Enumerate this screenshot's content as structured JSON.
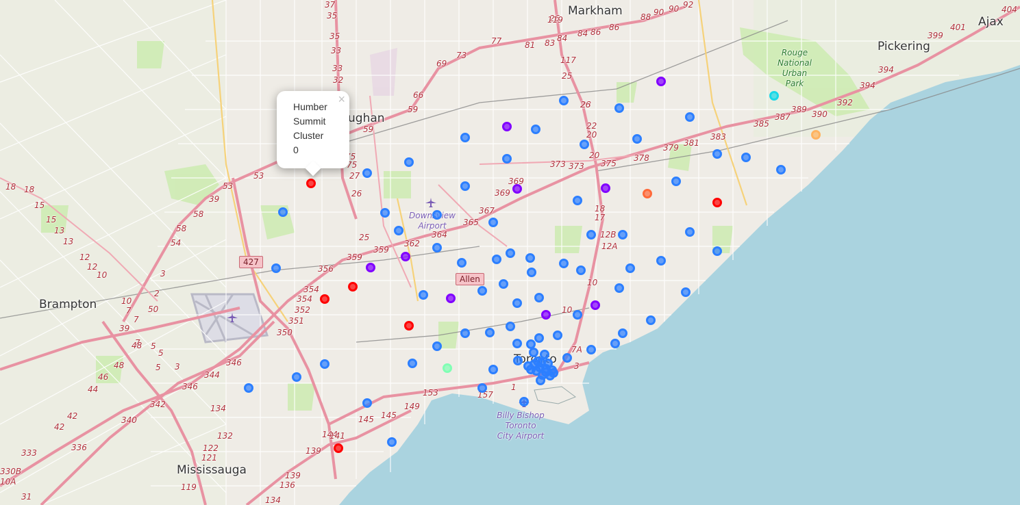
{
  "map": {
    "places": [
      {
        "id": "markham",
        "label": "Markham",
        "kind": "city"
      },
      {
        "id": "ajax",
        "label": "Ajax",
        "kind": "city"
      },
      {
        "id": "pickering",
        "label": "Pickering",
        "kind": "city"
      },
      {
        "id": "vaughan",
        "label": "ughan",
        "kind": "city"
      },
      {
        "id": "brampton",
        "label": "Brampton",
        "kind": "city"
      },
      {
        "id": "mississauga",
        "label": "Mississauga",
        "kind": "city"
      },
      {
        "id": "toronto",
        "label": "Toronto",
        "kind": "city"
      }
    ],
    "park_label": [
      "Rouge",
      "National",
      "Urban",
      "Park"
    ],
    "airports": {
      "downsview": [
        "Downsview",
        "Airport"
      ],
      "billy_bishop": [
        "Billy Bishop",
        "Toronto",
        "City Airport"
      ]
    },
    "boxed_label": "Allen",
    "boxed_route": "427",
    "route_numbers": [
      "37",
      "35",
      "35",
      "33",
      "33",
      "32",
      "26",
      "77",
      "81",
      "83",
      "84",
      "84",
      "86",
      "86",
      "88",
      "90",
      "90",
      "92",
      "404",
      "401",
      "399",
      "394",
      "394",
      "392",
      "390",
      "389",
      "387",
      "385",
      "383",
      "381",
      "379",
      "378",
      "375",
      "373",
      "373",
      "369",
      "369",
      "367",
      "365",
      "364",
      "362",
      "359",
      "359",
      "356",
      "354",
      "354",
      "352",
      "351",
      "350",
      "346",
      "346",
      "344",
      "342",
      "340",
      "336",
      "333",
      "330B",
      "10A",
      "31",
      "18",
      "18",
      "15",
      "15",
      "13",
      "13",
      "12",
      "12",
      "10",
      "10",
      "7",
      "7",
      "7",
      "5",
      "5",
      "5",
      "3",
      "3",
      "2",
      "50",
      "48",
      "48",
      "46",
      "44",
      "42",
      "42",
      "39",
      "39",
      "58",
      "58",
      "54",
      "53",
      "53",
      "59",
      "59",
      "66",
      "69",
      "73",
      "75",
      "75",
      "27",
      "26",
      "25",
      "25",
      "23",
      "22",
      "20",
      "20",
      "18",
      "17",
      "12B",
      "12A",
      "10",
      "10",
      "7A",
      "3",
      "1",
      "157",
      "153",
      "149",
      "145",
      "145",
      "144",
      "141",
      "139",
      "139",
      "136",
      "134",
      "134",
      "132",
      "122",
      "121",
      "119",
      "119",
      "117",
      "26",
      "26",
      "20"
    ],
    "colors": {
      "cluster_0": "#ff0000",
      "cluster_1": "#8000ff",
      "cluster_2": "#2c7fff",
      "cluster_3": "#1ad8e8",
      "cluster_4": "#80ffb4",
      "cluster_5": "#ffb360",
      "cluster_6": "#ff6a3a",
      "water": "#aad3df",
      "land": "#efece6",
      "motorway": "#e892a2",
      "park": "#cdebb0"
    }
  },
  "markers": {
    "cluster_0": 6,
    "cluster_1": 9,
    "cluster_2": 84,
    "cluster_3": 1,
    "cluster_4": 1,
    "cluster_5": 1,
    "cluster_6": 1
  },
  "popup": {
    "line1": "Humber",
    "line2": "Summit",
    "line3": "Cluster",
    "line4": "0",
    "close": "×"
  }
}
